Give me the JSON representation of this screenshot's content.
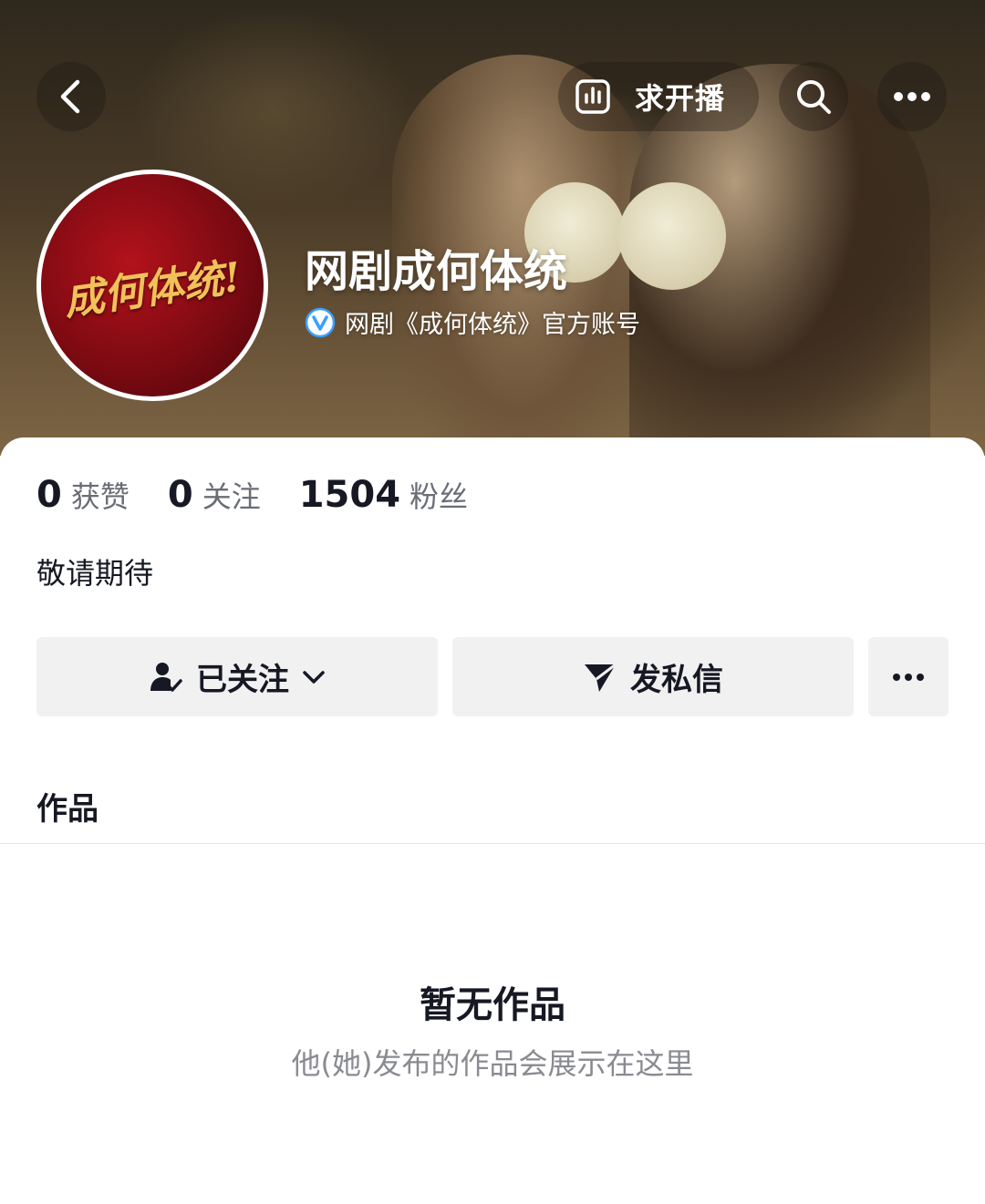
{
  "header": {
    "live_label": "求开播",
    "icons": {
      "back": "chevron-left-icon",
      "live": "bar-chart-icon",
      "search": "search-icon",
      "more": "more-horizontal-icon"
    }
  },
  "profile": {
    "avatar_text": "成何体统!",
    "name": "网剧成何体统",
    "verify_text": "网剧《成何体统》官方账号",
    "verify_color": "#3aa0ff"
  },
  "stats": [
    {
      "value": "0",
      "label": "获赞"
    },
    {
      "value": "0",
      "label": "关注"
    },
    {
      "value": "1504",
      "label": "粉丝"
    }
  ],
  "bio": "敬请期待",
  "actions": {
    "follow_label": "已关注",
    "message_label": "发私信"
  },
  "works": {
    "tab_title": "作品",
    "empty_title": "暂无作品",
    "empty_subtitle": "他(她)发布的作品会展示在这里"
  },
  "colors": {
    "button_bg": "#f1f1f2",
    "text_primary": "#161823",
    "text_secondary": "#8a8b91"
  }
}
